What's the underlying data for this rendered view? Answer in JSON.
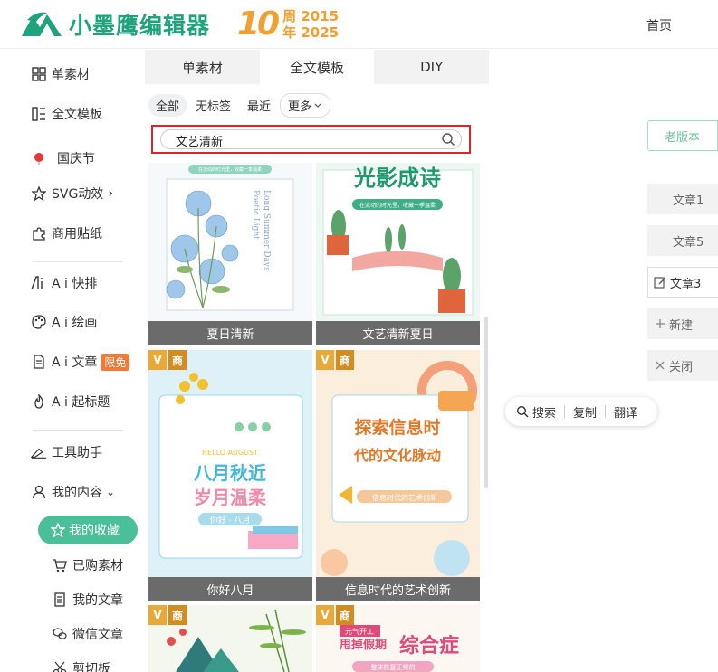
{
  "header": {
    "logo_text": "小墨鹰编辑器",
    "anniversary_number": "10",
    "anniversary_line1": "周 2015",
    "anniversary_line2": "年 2025",
    "nav_home": "首页"
  },
  "sidebar": {
    "items": [
      {
        "label": "单素材",
        "icon": "grid-icon"
      },
      {
        "label": "全文模板",
        "icon": "layout-icon"
      },
      {
        "label": "国庆节",
        "icon": "red-dot-icon"
      },
      {
        "label": "SVG动效",
        "icon": "star-outline-icon"
      },
      {
        "label": "商用贴纸",
        "icon": "puzzle-icon"
      },
      {
        "label": "A i 快排",
        "icon": "ai-icon"
      },
      {
        "label": "A i 绘画",
        "icon": "palette-icon"
      },
      {
        "label": "A i 文章",
        "icon": "document-icon",
        "badge": "限免"
      },
      {
        "label": "A i 起标题",
        "icon": "flame-icon"
      },
      {
        "label": "工具助手",
        "icon": "tools-icon"
      },
      {
        "label": "我的内容",
        "icon": "user-icon"
      }
    ],
    "sub_items": [
      {
        "label": "我的收藏",
        "icon": "star-icon"
      },
      {
        "label": "已购素材",
        "icon": "cart-icon"
      },
      {
        "label": "我的文章",
        "icon": "article-icon"
      },
      {
        "label": "微信文章",
        "icon": "wechat-icon"
      },
      {
        "label": "剪切板",
        "icon": "scissors-icon"
      }
    ],
    "svg_chevron": "›",
    "mine_chevron": "⌄"
  },
  "panel": {
    "tabs": [
      "单素材",
      "全文模板",
      "DIY"
    ],
    "active_tab": 1,
    "filters": [
      "全部",
      "无标签",
      "最近",
      "更多"
    ],
    "search_value": "文艺清新",
    "cards": [
      {
        "caption": "夏日清新",
        "title": "",
        "subtitle_en1": "Long Summer Days",
        "subtitle_en2": "Poetic Light",
        "top_text": "在流动的时光里，收藏一季温柔"
      },
      {
        "caption": "文艺清新夏日",
        "title": "光影成诗",
        "top_text": "在流动的时光里，收藏一季温柔"
      },
      {
        "caption": "你好八月",
        "title1": "八月秋近",
        "title2": "岁月温柔",
        "small": "HELLO AUGUST",
        "tag": "你好 · 八月",
        "badge_v": "V",
        "badge_s": "商"
      },
      {
        "caption": "信息时代的艺术创新",
        "title1": "探索信息时",
        "title2": "代的文化脉动",
        "tag": "信息时代的艺术创新",
        "badge_v": "V",
        "badge_s": "商"
      },
      {
        "caption": "",
        "badge_v": "V",
        "badge_s": "商"
      },
      {
        "caption": "",
        "title": "综合症",
        "tag1": "元气开工",
        "tag2": "甩掉假期",
        "tag3": "整体恢复正常的",
        "badge_v": "V",
        "badge_s": "商"
      }
    ]
  },
  "right": {
    "old_version": "老版本",
    "doc_tabs": [
      "文章1",
      "文章5",
      "文章3"
    ],
    "new_label": "新建",
    "close_label": "关闭"
  },
  "context_menu": {
    "search": "搜索",
    "copy": "复制",
    "translate": "翻译"
  },
  "colors": {
    "brand": "#1fa37f",
    "accent": "#4bbf99",
    "highlight": "#d62828",
    "anniversary": "#f0a030"
  }
}
